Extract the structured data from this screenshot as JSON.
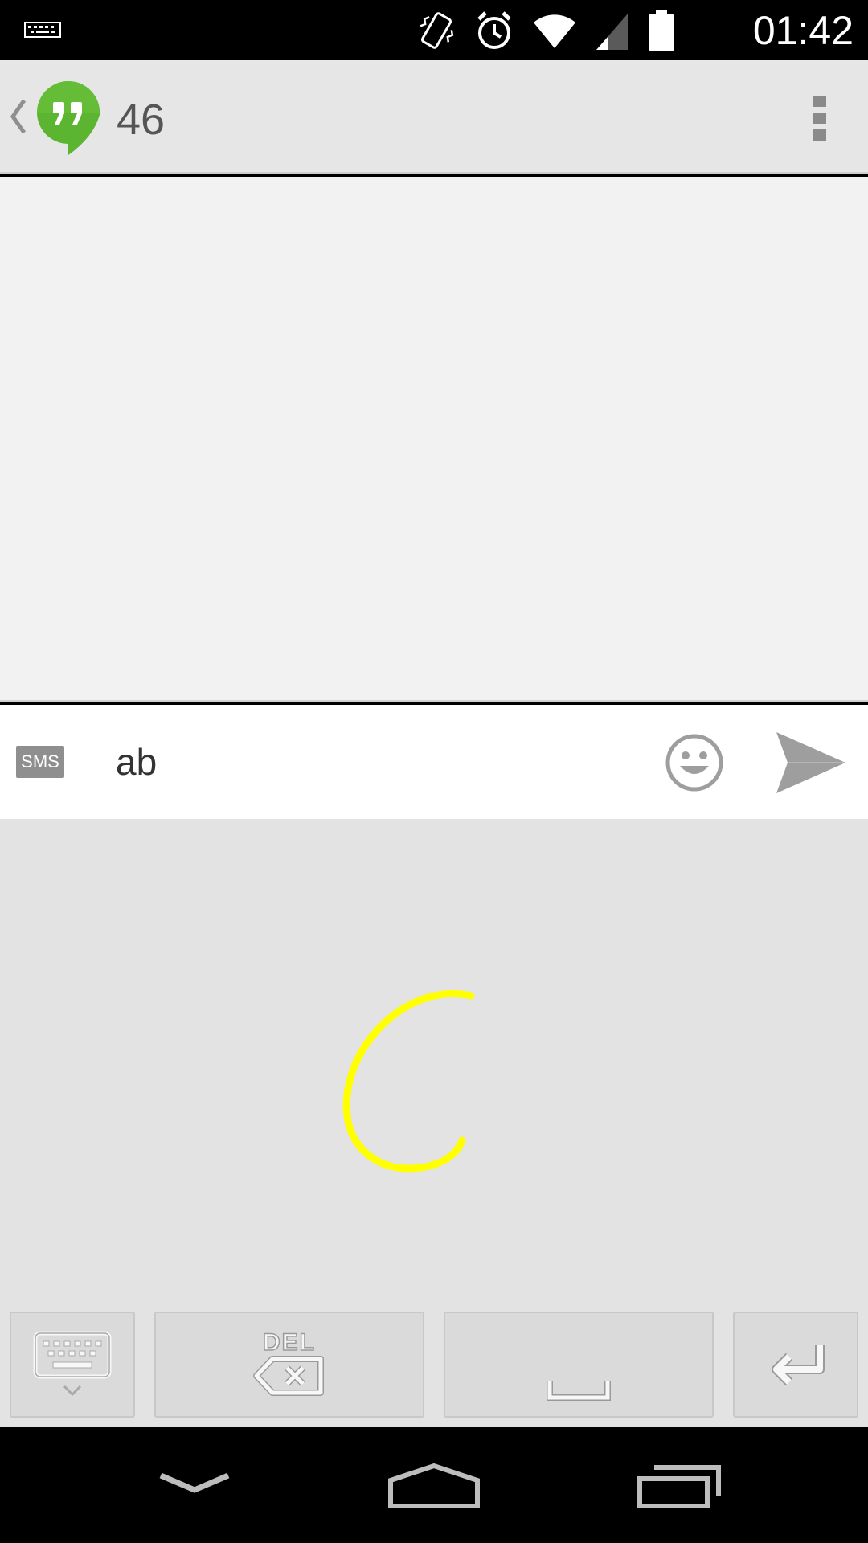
{
  "status_bar": {
    "time": "01:42",
    "icons": [
      "keyboard-notification-icon",
      "vibrate-icon",
      "alarm-icon",
      "wifi-icon",
      "cell-signal-icon",
      "battery-icon"
    ]
  },
  "action_bar": {
    "title": "46",
    "app_icon": "hangouts-icon",
    "accent_color": "#5cb531"
  },
  "compose": {
    "sms_label": "SMS",
    "message_text": "ab"
  },
  "keyboard": {
    "del_label": "DEL",
    "ink_color": "#ffff00",
    "keys": [
      "hide-keyboard",
      "delete",
      "space",
      "enter"
    ]
  },
  "nav_bar": {
    "buttons": [
      "back",
      "home",
      "recents"
    ]
  }
}
